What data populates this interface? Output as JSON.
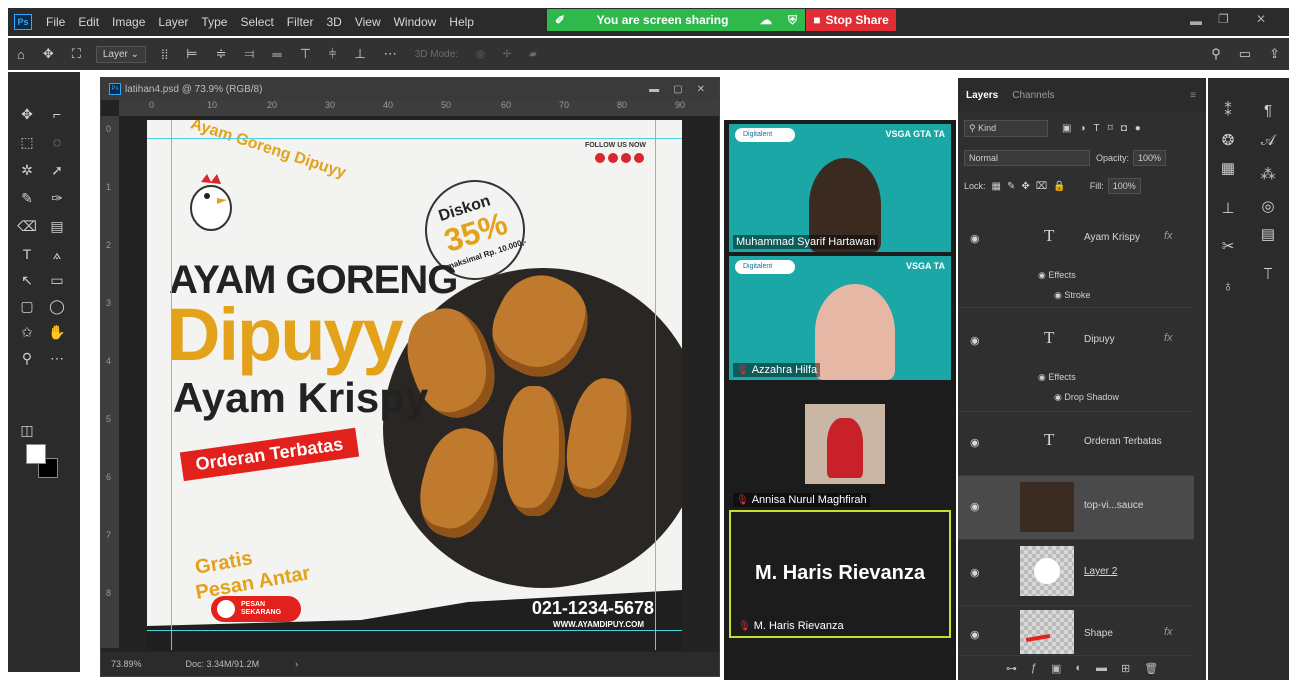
{
  "menu": {
    "logo": "Ps",
    "items": [
      "File",
      "Edit",
      "Image",
      "Layer",
      "Type",
      "Select",
      "Filter",
      "3D",
      "View",
      "Window",
      "Help"
    ]
  },
  "share": {
    "banner_text": "You are screen sharing",
    "stop_label": "Stop Share",
    "banner_color": "#2fb84b",
    "stop_color": "#e02d36"
  },
  "options": {
    "layer_select": "Layer",
    "mode_3d": "3D Mode:"
  },
  "document": {
    "tab_title": "latihan4.psd @ 73.9% (RGB/8)",
    "ruler_h": [
      "0",
      "10",
      "20",
      "30",
      "40",
      "50",
      "60",
      "70",
      "80",
      "90"
    ],
    "ruler_v": [
      "0",
      "1",
      "2",
      "3",
      "4",
      "5",
      "6",
      "7",
      "8"
    ],
    "zoom": "73.89%",
    "doc_size": "Doc: 3.34M/91.2M"
  },
  "artwork": {
    "brand": "Ayam Goreng Dipuyy",
    "follow": "FOLLOW US NOW",
    "diskon_label": "Diskon",
    "diskon_value": "35%",
    "diskon_note": "maksimal Rp. 10.000,-",
    "headline1": "AYAM GORENG",
    "headline2": "Dipuyy",
    "headline3": "Ayam Krispy",
    "badge": "Orderan Terbatas",
    "gratis1": "Gratis",
    "gratis2": "Pesan Antar",
    "pesan_btn": "PESAN SEKARANG",
    "phone": "021-1234-5678",
    "website": "WWW.AYAMDIPUY.COM",
    "accent_color": "#e3a21a",
    "red_color": "#e2211c"
  },
  "zoom": {
    "participants": [
      {
        "name": "Muhammad Syarif Hartawan",
        "muted": false
      },
      {
        "name": "Azzahra Hilfa",
        "muted": true
      },
      {
        "name": "Annisa Nurul Maghfirah",
        "muted": true
      },
      {
        "name": "M. Haris Rievanza",
        "muted": true
      }
    ],
    "active_name_big": "M. Haris Rievanza",
    "tile_logo": "Digitalent",
    "tile_vsga_1": "VSGA    GTA    TA",
    "tile_vsga_2": "VSGA    TA"
  },
  "layers_panel": {
    "tabs": [
      "Layers",
      "Channels"
    ],
    "kind": "Kind",
    "blend_mode": "Normal",
    "opacity_label": "Opacity:",
    "opacity_value": "100%",
    "lock_label": "Lock:",
    "fill_label": "Fill:",
    "fill_value": "100%",
    "layers": [
      {
        "name": "Ayam Krispy",
        "type": "text",
        "fx": "fx",
        "effects": [
          "Effects",
          "Stroke"
        ]
      },
      {
        "name": "Dipuyy",
        "type": "text",
        "fx": "fx",
        "effects": [
          "Effects",
          "Drop Shadow"
        ]
      },
      {
        "name": "Orderan Terbatas",
        "type": "text"
      },
      {
        "name": "top-vi...sauce",
        "type": "smart-object"
      },
      {
        "name": "Layer 2",
        "type": "pixel"
      },
      {
        "name": "Shape",
        "type": "shape",
        "fx": "fx"
      }
    ]
  }
}
